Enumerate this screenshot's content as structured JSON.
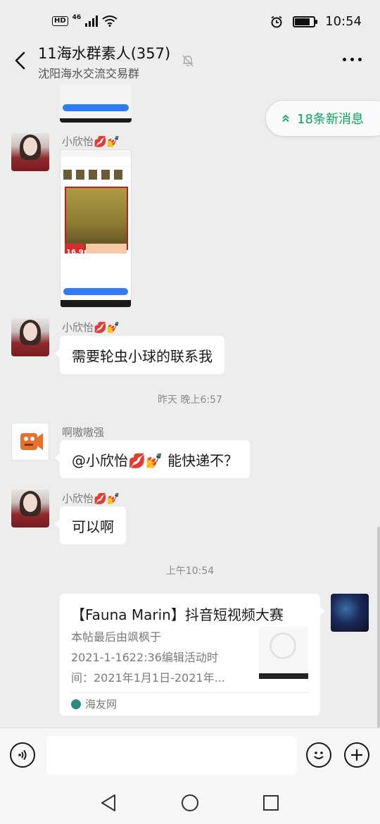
{
  "status_bar": {
    "hd": "HD",
    "network": "46",
    "time": "10:54",
    "battery_level": 0.8
  },
  "header": {
    "title": "11海水群素人(357)",
    "subtitle": "沈阳海水交流交易群"
  },
  "new_messages": "18条新消息",
  "messages": {
    "m1_sender": "小欣怡💋💅",
    "m2_sender": "小欣怡💋💅",
    "m2_text": "需要轮虫小球的联系我",
    "ts1": "昨天 晚上6:57",
    "m3_sender": "啊嗷嗷强",
    "m3_text": "@小欣怡💋💅 能快递不？",
    "m4_sender": "小欣怡💋💅",
    "m4_text": "可以啊",
    "ts2": "上午10:54"
  },
  "shot": {
    "price": "16.9"
  },
  "card": {
    "title": "【Fauna Marin】抖音短视频大赛",
    "desc_line1": "本帖最后由飒枫于",
    "desc_line2": "2021-1-1622:36编辑活动时",
    "desc_line3": "间：2021年1月1日-2021年...",
    "source": "海友网"
  },
  "icons": [
    "back-arrow-icon",
    "mute-bell-icon",
    "more-icon",
    "double-chevron-up-icon",
    "voice-icon",
    "emoji-icon",
    "plus-icon",
    "nav-back-icon",
    "nav-home-icon",
    "nav-recents-icon"
  ]
}
